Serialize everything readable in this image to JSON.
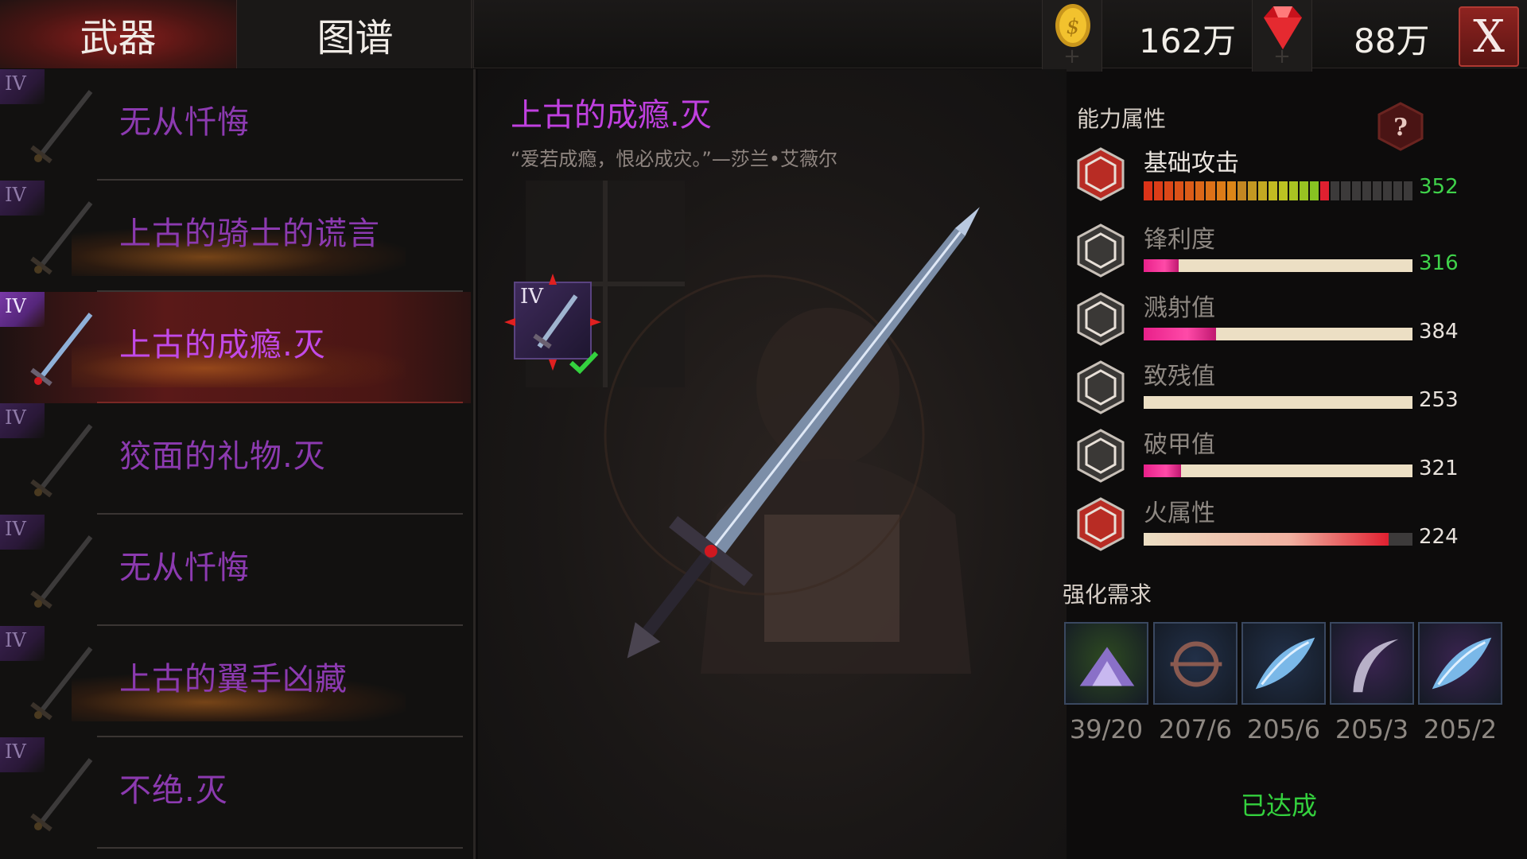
{
  "tabs": [
    {
      "label": "武器",
      "active": true
    },
    {
      "label": "图谱",
      "active": false
    }
  ],
  "currency": {
    "gold": {
      "icon": "gold-coin-icon",
      "value": "162万"
    },
    "gem": {
      "icon": "red-gem-icon",
      "value": "88万"
    }
  },
  "close_label": "X",
  "weapon_list": [
    {
      "rank": "IV",
      "name": "无从忏悔",
      "selected": false
    },
    {
      "rank": "IV",
      "name": "上古的骑士的谎言",
      "selected": false
    },
    {
      "rank": "IV",
      "name": "上古的成瘾.灭",
      "selected": true
    },
    {
      "rank": "IV",
      "name": "狡面的礼物.灭",
      "selected": false
    },
    {
      "rank": "IV",
      "name": "无从忏悔",
      "selected": false
    },
    {
      "rank": "IV",
      "name": "上古的翼手凶藏",
      "selected": false
    },
    {
      "rank": "IV",
      "name": "不绝.灭",
      "selected": false
    }
  ],
  "detail": {
    "title": "上古的成瘾.灭",
    "quote": "“爱若成瘾，恨必成灾。”—莎兰•艾薇尔",
    "slot_rank": "IV",
    "equipped": true
  },
  "stats": {
    "title": "能力属性",
    "rows": [
      {
        "icon": "sword-attack-icon",
        "label": "基础攻击",
        "value": "352",
        "fill": 0.7,
        "highlight": true
      },
      {
        "icon": "sharpness-icon",
        "label": "锋利度",
        "value": "316",
        "fill": 0.13,
        "highlight": true
      },
      {
        "icon": "splash-icon",
        "label": "溅射值",
        "value": "384",
        "fill": 0.27,
        "highlight": false
      },
      {
        "icon": "cripple-icon",
        "label": "致残值",
        "value": "253",
        "fill": 0.0,
        "highlight": false
      },
      {
        "icon": "armor-break-icon",
        "label": "破甲值",
        "value": "321",
        "fill": 0.14,
        "highlight": false
      },
      {
        "icon": "fire-icon",
        "label": "火属性",
        "value": "224",
        "fill": 0.91,
        "highlight": false
      }
    ]
  },
  "upgrade": {
    "title": "强化需求",
    "materials": [
      {
        "icon": "purple-dust-icon",
        "count": "39/20",
        "bg": "#2e4a22"
      },
      {
        "icon": "wheel-part-icon",
        "count": "207/6",
        "bg": "#223048"
      },
      {
        "icon": "blue-feather-icon",
        "count": "205/6",
        "bg": "#223048"
      },
      {
        "icon": "curved-blade-icon",
        "count": "205/3",
        "bg": "#3a2450"
      },
      {
        "icon": "blue-feather-icon",
        "count": "205/2",
        "bg": "#3a2450"
      }
    ],
    "status": "已达成"
  },
  "colors": {
    "rank_purple": "#c24ae8",
    "accent_red": "#8e2320",
    "stat_green": "#3fd24a",
    "bar_pink": "#e0308a"
  }
}
